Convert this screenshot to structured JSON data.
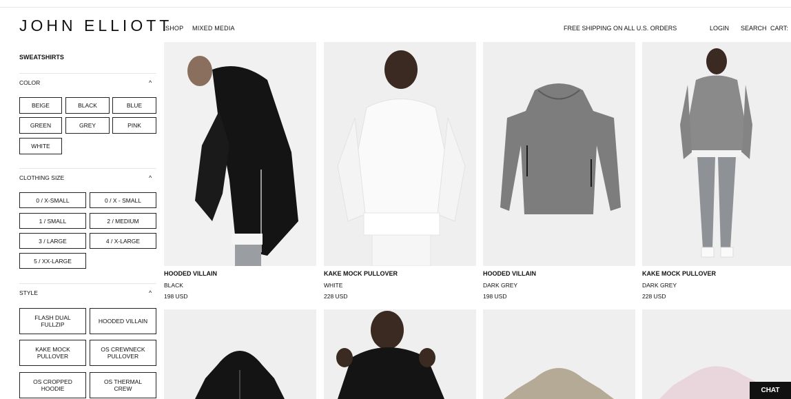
{
  "header": {
    "logo": "JOHN ELLIOTT",
    "nav": [
      "SHOP",
      "MIXED MEDIA"
    ],
    "shipping": "FREE SHIPPING ON ALL U.S. ORDERS",
    "login": "LOGIN",
    "search": "SEARCH",
    "cart": "CART:"
  },
  "sidebar": {
    "title": "SWEATSHIRTS",
    "color": {
      "label": "COLOR",
      "options": [
        "BEIGE",
        "BLACK",
        "BLUE",
        "GREEN",
        "GREY",
        "PINK",
        "WHITE"
      ]
    },
    "size": {
      "label": "CLOTHING SIZE",
      "options": [
        "0 / X-SMALL",
        "0 / X - SMALL",
        "1 / SMALL",
        "2 / MEDIUM",
        "3 / LARGE",
        "4 / X-LARGE",
        "5 / XX-LARGE"
      ]
    },
    "style": {
      "label": "STYLE",
      "options": [
        "FLASH DUAL FULLZIP",
        "HOODED VILLAIN",
        "KAKE MOCK PULLOVER",
        "OS CREWNECK PULLOVER",
        "OS CROPPED HOODIE",
        "OS THERMAL CREW"
      ]
    }
  },
  "products": [
    {
      "name": "HOODED VILLAIN",
      "color": "BLACK",
      "price": "198 USD"
    },
    {
      "name": "KAKE MOCK PULLOVER",
      "color": "WHITE",
      "price": "228 USD"
    },
    {
      "name": "HOODED VILLAIN",
      "color": "DARK GREY",
      "price": "198 USD"
    },
    {
      "name": "KAKE MOCK PULLOVER",
      "color": "DARK GREY",
      "price": "228 USD"
    }
  ],
  "chat": "CHAT",
  "colors": {
    "text": "#111111",
    "image_bg": "#efefef",
    "chat_bg": "#111111"
  }
}
